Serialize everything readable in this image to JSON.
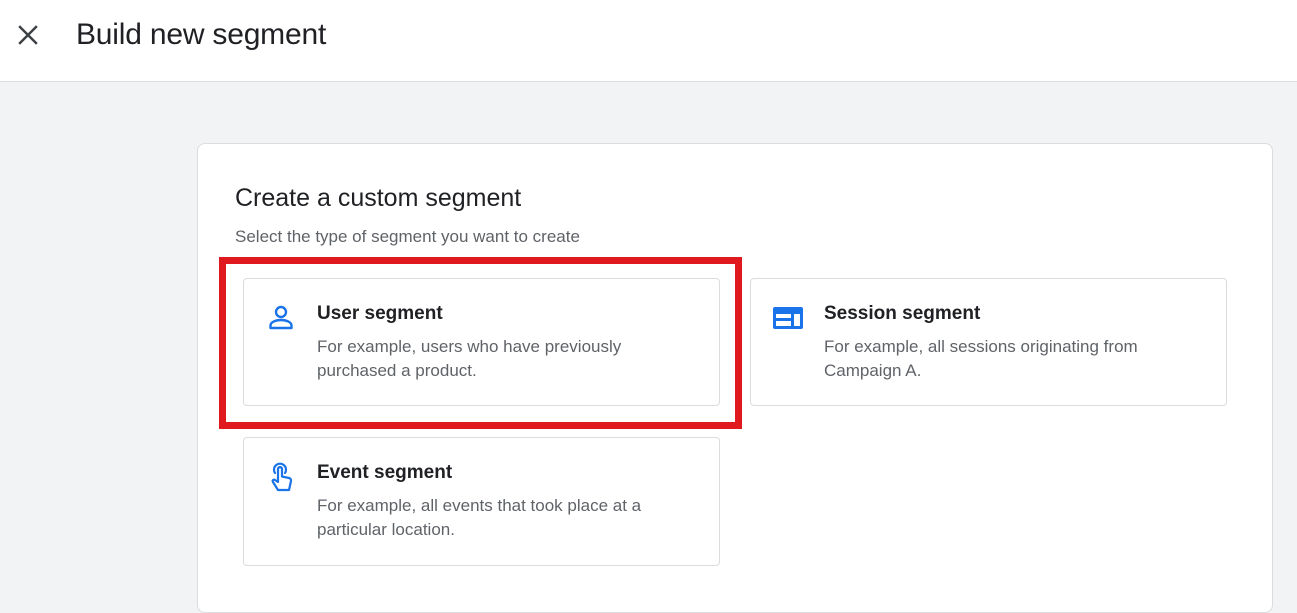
{
  "header": {
    "title": "Build new segment",
    "close_icon": "close-icon"
  },
  "panel": {
    "title": "Create a custom segment",
    "subtitle": "Select the type of segment you want to create"
  },
  "segment_options": [
    {
      "icon": "person-icon",
      "title": "User segment",
      "description": "For example, users who have previously purchased a product.",
      "highlighted": true
    },
    {
      "icon": "session-icon",
      "title": "Session segment",
      "description": "For example, all sessions originating from Campaign A.",
      "highlighted": false
    },
    {
      "icon": "touch-icon",
      "title": "Event segment",
      "description": "For example, all events that took place at a particular location.",
      "highlighted": false
    }
  ],
  "colors": {
    "accent": "#1a73e8",
    "highlight_border": "#e0191e",
    "background": "#f1f3f4"
  }
}
